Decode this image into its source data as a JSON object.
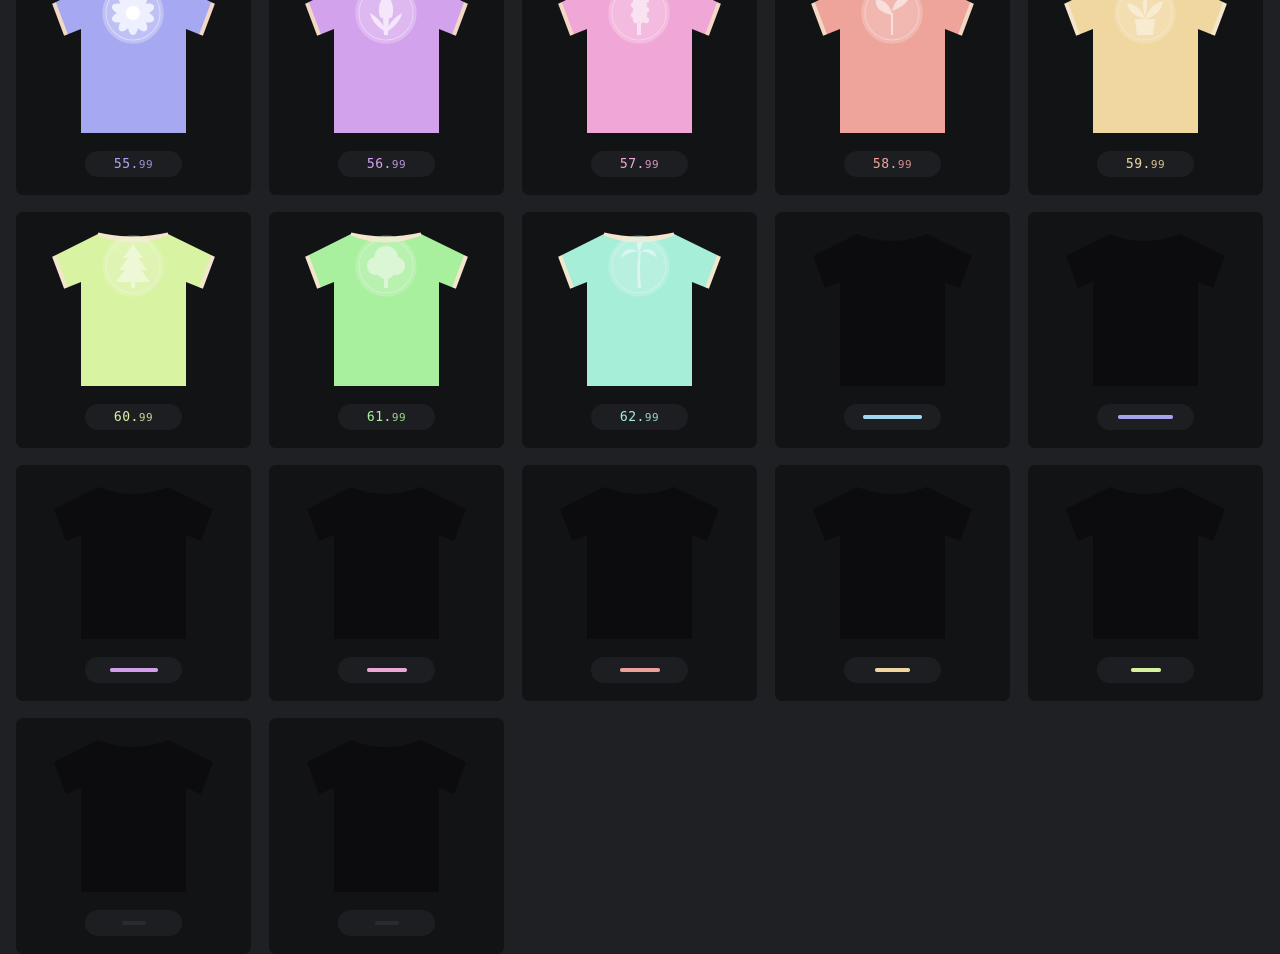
{
  "products": [
    {
      "price_whole": "55",
      "price_sep": ".",
      "price_cents": "99",
      "color": "#a6a8f1",
      "accent": "#eef0ff",
      "trim": "#f3d8c4",
      "icon": "daisy-icon",
      "available": true
    },
    {
      "price_whole": "56",
      "price_sep": ".",
      "price_cents": "99",
      "color": "#d3a2ec",
      "accent": "#f4e6fb",
      "trim": "#f3d8c4",
      "icon": "tulip-icon",
      "available": true
    },
    {
      "price_whole": "57",
      "price_sep": ".",
      "price_cents": "99",
      "color": "#f0a6d6",
      "accent": "#f9e3f1",
      "trim": "#f3d8c4",
      "icon": "hyacinth-icon",
      "available": true
    },
    {
      "price_whole": "58",
      "price_sep": ".",
      "price_cents": "99",
      "color": "#eea39b",
      "accent": "#f8dfdb",
      "trim": "#f3d8c4",
      "icon": "sprout-icon",
      "available": true
    },
    {
      "price_whole": "59",
      "price_sep": ".",
      "price_cents": "99",
      "color": "#f0d7a0",
      "accent": "#f7ecd2",
      "trim": "#f3e6cc",
      "icon": "potted-plant-icon",
      "available": true
    },
    {
      "price_whole": "60",
      "price_sep": ".",
      "price_cents": "99",
      "color": "#d8f3a1",
      "accent": "#eef8d6",
      "trim": "#f3e6cc",
      "icon": "pine-tree-icon",
      "available": true
    },
    {
      "price_whole": "61",
      "price_sep": ".",
      "price_cents": "99",
      "color": "#a8ef9e",
      "accent": "#dbf6d5",
      "trim": "#f3e6cc",
      "icon": "broadleaf-tree-icon",
      "available": true
    },
    {
      "price_whole": "62",
      "price_sep": ".",
      "price_cents": "99",
      "color": "#a6eed8",
      "accent": "#daf6ee",
      "trim": "#f3e6cc",
      "icon": "palm-tree-icon",
      "available": true
    },
    {
      "color": "#9fd7ef",
      "available": false
    },
    {
      "color": "#a6a3ee",
      "available": false
    },
    {
      "color": "#d2a0ea",
      "available": false
    },
    {
      "color": "#eea6d6",
      "available": false
    },
    {
      "color": "#e9a19a",
      "available": false
    },
    {
      "color": "#efd6a1",
      "available": false
    },
    {
      "color": "#d6f29e",
      "available": false
    },
    {
      "color": "#2a2b30",
      "available": false
    },
    {
      "color": "#2a2b30",
      "available": false
    }
  ]
}
